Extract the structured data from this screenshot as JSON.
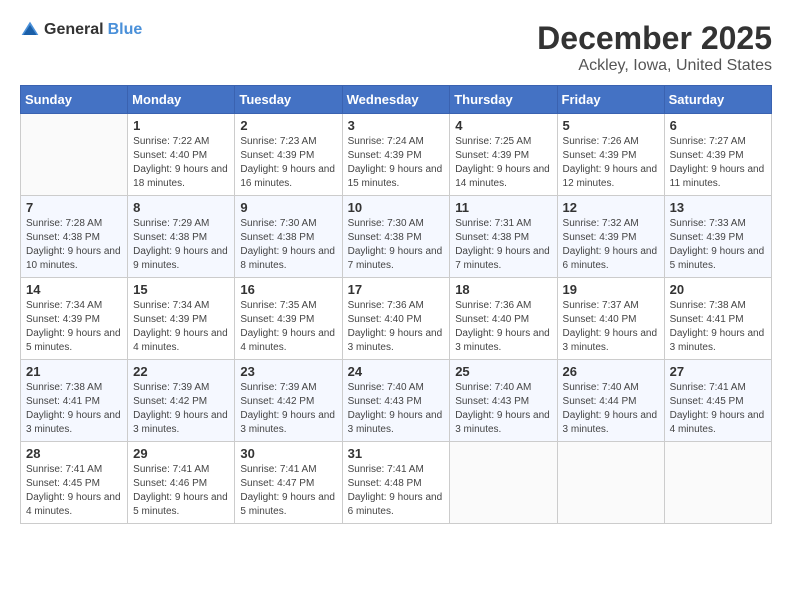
{
  "header": {
    "logo_general": "General",
    "logo_blue": "Blue",
    "month": "December 2025",
    "location": "Ackley, Iowa, United States"
  },
  "days_of_week": [
    "Sunday",
    "Monday",
    "Tuesday",
    "Wednesday",
    "Thursday",
    "Friday",
    "Saturday"
  ],
  "weeks": [
    [
      {
        "day": "",
        "sunrise": "",
        "sunset": "",
        "daylight": ""
      },
      {
        "day": "1",
        "sunrise": "Sunrise: 7:22 AM",
        "sunset": "Sunset: 4:40 PM",
        "daylight": "Daylight: 9 hours and 18 minutes."
      },
      {
        "day": "2",
        "sunrise": "Sunrise: 7:23 AM",
        "sunset": "Sunset: 4:39 PM",
        "daylight": "Daylight: 9 hours and 16 minutes."
      },
      {
        "day": "3",
        "sunrise": "Sunrise: 7:24 AM",
        "sunset": "Sunset: 4:39 PM",
        "daylight": "Daylight: 9 hours and 15 minutes."
      },
      {
        "day": "4",
        "sunrise": "Sunrise: 7:25 AM",
        "sunset": "Sunset: 4:39 PM",
        "daylight": "Daylight: 9 hours and 14 minutes."
      },
      {
        "day": "5",
        "sunrise": "Sunrise: 7:26 AM",
        "sunset": "Sunset: 4:39 PM",
        "daylight": "Daylight: 9 hours and 12 minutes."
      },
      {
        "day": "6",
        "sunrise": "Sunrise: 7:27 AM",
        "sunset": "Sunset: 4:39 PM",
        "daylight": "Daylight: 9 hours and 11 minutes."
      }
    ],
    [
      {
        "day": "7",
        "sunrise": "Sunrise: 7:28 AM",
        "sunset": "Sunset: 4:38 PM",
        "daylight": "Daylight: 9 hours and 10 minutes."
      },
      {
        "day": "8",
        "sunrise": "Sunrise: 7:29 AM",
        "sunset": "Sunset: 4:38 PM",
        "daylight": "Daylight: 9 hours and 9 minutes."
      },
      {
        "day": "9",
        "sunrise": "Sunrise: 7:30 AM",
        "sunset": "Sunset: 4:38 PM",
        "daylight": "Daylight: 9 hours and 8 minutes."
      },
      {
        "day": "10",
        "sunrise": "Sunrise: 7:30 AM",
        "sunset": "Sunset: 4:38 PM",
        "daylight": "Daylight: 9 hours and 7 minutes."
      },
      {
        "day": "11",
        "sunrise": "Sunrise: 7:31 AM",
        "sunset": "Sunset: 4:38 PM",
        "daylight": "Daylight: 9 hours and 7 minutes."
      },
      {
        "day": "12",
        "sunrise": "Sunrise: 7:32 AM",
        "sunset": "Sunset: 4:39 PM",
        "daylight": "Daylight: 9 hours and 6 minutes."
      },
      {
        "day": "13",
        "sunrise": "Sunrise: 7:33 AM",
        "sunset": "Sunset: 4:39 PM",
        "daylight": "Daylight: 9 hours and 5 minutes."
      }
    ],
    [
      {
        "day": "14",
        "sunrise": "Sunrise: 7:34 AM",
        "sunset": "Sunset: 4:39 PM",
        "daylight": "Daylight: 9 hours and 5 minutes."
      },
      {
        "day": "15",
        "sunrise": "Sunrise: 7:34 AM",
        "sunset": "Sunset: 4:39 PM",
        "daylight": "Daylight: 9 hours and 4 minutes."
      },
      {
        "day": "16",
        "sunrise": "Sunrise: 7:35 AM",
        "sunset": "Sunset: 4:39 PM",
        "daylight": "Daylight: 9 hours and 4 minutes."
      },
      {
        "day": "17",
        "sunrise": "Sunrise: 7:36 AM",
        "sunset": "Sunset: 4:40 PM",
        "daylight": "Daylight: 9 hours and 3 minutes."
      },
      {
        "day": "18",
        "sunrise": "Sunrise: 7:36 AM",
        "sunset": "Sunset: 4:40 PM",
        "daylight": "Daylight: 9 hours and 3 minutes."
      },
      {
        "day": "19",
        "sunrise": "Sunrise: 7:37 AM",
        "sunset": "Sunset: 4:40 PM",
        "daylight": "Daylight: 9 hours and 3 minutes."
      },
      {
        "day": "20",
        "sunrise": "Sunrise: 7:38 AM",
        "sunset": "Sunset: 4:41 PM",
        "daylight": "Daylight: 9 hours and 3 minutes."
      }
    ],
    [
      {
        "day": "21",
        "sunrise": "Sunrise: 7:38 AM",
        "sunset": "Sunset: 4:41 PM",
        "daylight": "Daylight: 9 hours and 3 minutes."
      },
      {
        "day": "22",
        "sunrise": "Sunrise: 7:39 AM",
        "sunset": "Sunset: 4:42 PM",
        "daylight": "Daylight: 9 hours and 3 minutes."
      },
      {
        "day": "23",
        "sunrise": "Sunrise: 7:39 AM",
        "sunset": "Sunset: 4:42 PM",
        "daylight": "Daylight: 9 hours and 3 minutes."
      },
      {
        "day": "24",
        "sunrise": "Sunrise: 7:40 AM",
        "sunset": "Sunset: 4:43 PM",
        "daylight": "Daylight: 9 hours and 3 minutes."
      },
      {
        "day": "25",
        "sunrise": "Sunrise: 7:40 AM",
        "sunset": "Sunset: 4:43 PM",
        "daylight": "Daylight: 9 hours and 3 minutes."
      },
      {
        "day": "26",
        "sunrise": "Sunrise: 7:40 AM",
        "sunset": "Sunset: 4:44 PM",
        "daylight": "Daylight: 9 hours and 3 minutes."
      },
      {
        "day": "27",
        "sunrise": "Sunrise: 7:41 AM",
        "sunset": "Sunset: 4:45 PM",
        "daylight": "Daylight: 9 hours and 4 minutes."
      }
    ],
    [
      {
        "day": "28",
        "sunrise": "Sunrise: 7:41 AM",
        "sunset": "Sunset: 4:45 PM",
        "daylight": "Daylight: 9 hours and 4 minutes."
      },
      {
        "day": "29",
        "sunrise": "Sunrise: 7:41 AM",
        "sunset": "Sunset: 4:46 PM",
        "daylight": "Daylight: 9 hours and 5 minutes."
      },
      {
        "day": "30",
        "sunrise": "Sunrise: 7:41 AM",
        "sunset": "Sunset: 4:47 PM",
        "daylight": "Daylight: 9 hours and 5 minutes."
      },
      {
        "day": "31",
        "sunrise": "Sunrise: 7:41 AM",
        "sunset": "Sunset: 4:48 PM",
        "daylight": "Daylight: 9 hours and 6 minutes."
      },
      {
        "day": "",
        "sunrise": "",
        "sunset": "",
        "daylight": ""
      },
      {
        "day": "",
        "sunrise": "",
        "sunset": "",
        "daylight": ""
      },
      {
        "day": "",
        "sunrise": "",
        "sunset": "",
        "daylight": ""
      }
    ]
  ]
}
